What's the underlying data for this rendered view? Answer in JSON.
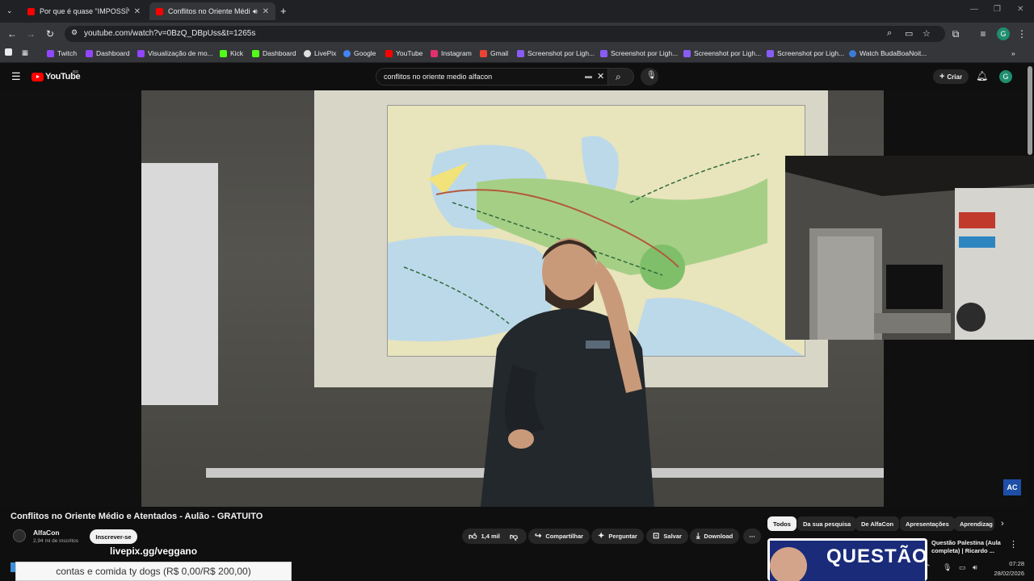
{
  "browser": {
    "tabs": [
      {
        "title": "Por que é quase \"IMPOSSÍVEL\"",
        "active": false
      },
      {
        "title": "Conflitos no Oriente Médio",
        "active": true
      }
    ],
    "new_tab": "+",
    "url": "youtube.com/watch?v=0BzQ_DBpUss&t=1265s",
    "bookmarks": [
      {
        "label": "Twitch",
        "color": "#9146ff"
      },
      {
        "label": "Dashboard",
        "color": "#9146ff"
      },
      {
        "label": "Visualização de mo...",
        "color": "#9146ff"
      },
      {
        "label": "Kick",
        "color": "#53fc18"
      },
      {
        "label": "Dashboard",
        "color": "#53fc18"
      },
      {
        "label": "LivePix",
        "color": "#e0e0e0"
      },
      {
        "label": "Google",
        "color": "#4285f4"
      },
      {
        "label": "YouTube",
        "color": "#ff0000"
      },
      {
        "label": "Instagram",
        "color": "#e1306c"
      },
      {
        "label": "Gmail",
        "color": "#ea4335"
      },
      {
        "label": "Screenshot por Ligh...",
        "color": "#8a5cf6"
      },
      {
        "label": "Screenshot por Ligh...",
        "color": "#8a5cf6"
      },
      {
        "label": "Screenshot por Ligh...",
        "color": "#8a5cf6"
      },
      {
        "label": "Screenshot por Ligh...",
        "color": "#8a5cf6"
      },
      {
        "label": "Watch BudaBoaNoit...",
        "color": "#3a7bd5"
      }
    ]
  },
  "youtube": {
    "logo_text": "YouTube",
    "region": "BR",
    "search_query": "conflitos no oriente medio alfacon",
    "create_label": "Criar",
    "avatar_letter": "G"
  },
  "video": {
    "title": "Conflitos no Oriente Médio e Atentados - Aulão - GRATUITO",
    "channel_logo": "AC",
    "channel_name": "AlfaCon",
    "subscribers": "2,94 mi de inscritos",
    "subscribe_label": "Inscrever-se",
    "likes": "1,4 mil",
    "actions": {
      "share": "Compartilhar",
      "ask": "Perguntar",
      "save": "Salvar",
      "download": "Download"
    }
  },
  "chips": [
    "Todos",
    "Da sua pesquisa",
    "De AlfaCon",
    "Apresentações",
    "Aprendizag"
  ],
  "recommendation": {
    "title": "Questão Palestina (Aula completa) | Ricardo ...",
    "thumb_word": "QUESTÃO"
  },
  "overlay": {
    "livepix_url": "livepix.gg/veggano",
    "goal_text": "contas e comida ty dogs (R$ 0,00/R$ 200,00)"
  },
  "taskbar": {
    "time": "07:28",
    "date": "28/02/2026"
  }
}
